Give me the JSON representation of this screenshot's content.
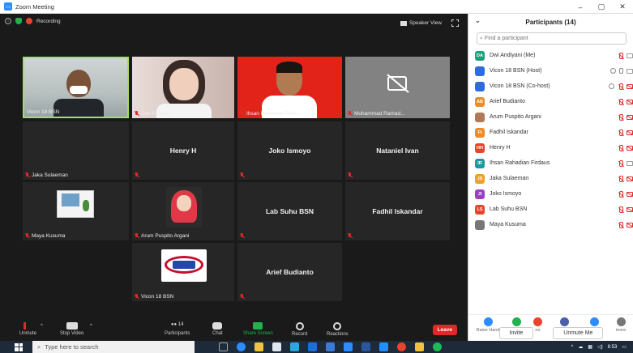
{
  "window": {
    "title": "Zoom Meeting"
  },
  "status": {
    "recording_label": "Recording",
    "view_label": "Speaker View"
  },
  "tiles": [
    {
      "name": "Vicon 18 BSN",
      "kind": "video"
    },
    {
      "name": "Dwi Andiyani",
      "kind": "video"
    },
    {
      "name": "Ihsan Rahadian Firda...",
      "kind": "video"
    },
    {
      "name": "Muhammad Ramad...",
      "kind": "camera-off"
    },
    {
      "name": "Jaka Sulaeman",
      "kind": "blank"
    },
    {
      "name": "Henry H",
      "kind": "name"
    },
    {
      "name": "Joko Ismoyo",
      "kind": "name"
    },
    {
      "name": "Nataniel Ivan",
      "kind": "name"
    },
    {
      "name": "Maya Kusuma",
      "kind": "video"
    },
    {
      "name": "Arum Puspito Argani",
      "kind": "video"
    },
    {
      "name": "Lab Suhu BSN",
      "kind": "name"
    },
    {
      "name": "Fadhil Iskandar",
      "kind": "name"
    },
    {
      "name": "Vicon 18 BSN",
      "kind": "logo"
    },
    {
      "name": "Arief Budianto",
      "kind": "name"
    }
  ],
  "controls": {
    "unmute": "Unmute",
    "stop_video": "Stop Video",
    "participants": "Participants",
    "participants_count": "14",
    "chat": "Chat",
    "share_screen": "Share Screen",
    "record": "Record",
    "reactions": "Reactions",
    "leave": "Leave"
  },
  "panel": {
    "title": "Participants (14)",
    "search_placeholder": "Find a participant",
    "participants": [
      {
        "initials": "DA",
        "name": "Dwi Andiyani (Me)",
        "color": "#1aa179"
      },
      {
        "initials": "",
        "name": "Vicon 18 BSN (Host)",
        "color": "#2d6cdf"
      },
      {
        "initials": "",
        "name": "Vicon 18 BSN (Co-host)",
        "color": "#2d6cdf"
      },
      {
        "initials": "AB",
        "name": "Arief Budianto",
        "color": "#f08a24"
      },
      {
        "initials": "",
        "name": "Arum Puspito Argani",
        "color": "#b07a5a"
      },
      {
        "initials": "FI",
        "name": "Fadhil Iskandar",
        "color": "#f08a24"
      },
      {
        "initials": "HH",
        "name": "Henry H",
        "color": "#e8432b"
      },
      {
        "initials": "IR",
        "name": "Ihsan Rahadian Firdaus",
        "color": "#1a9aa1"
      },
      {
        "initials": "JS",
        "name": "Jaka Sulaeman",
        "color": "#f0a024"
      },
      {
        "initials": "JI",
        "name": "Joko Ismoyo",
        "color": "#9b3fc9"
      },
      {
        "initials": "LS",
        "name": "Lab Suhu BSN",
        "color": "#e8432b"
      },
      {
        "initials": "",
        "name": "Maya Kusuma",
        "color": "#777777"
      }
    ],
    "reactions": [
      {
        "label": "Raise Hand",
        "color": "#2d8cff"
      },
      {
        "label": "yes",
        "color": "#22b14c"
      },
      {
        "label": "no",
        "color": "#e8432b"
      },
      {
        "label": "go slower",
        "color": "#4a5fa8"
      },
      {
        "label": "go faster",
        "color": "#2d8cff"
      },
      {
        "label": "more",
        "color": "#777777"
      }
    ],
    "invite": "Invite",
    "unmute_me": "Unmute Me"
  },
  "taskbar": {
    "search_placeholder": "Type here to search",
    "time": "8:53"
  }
}
